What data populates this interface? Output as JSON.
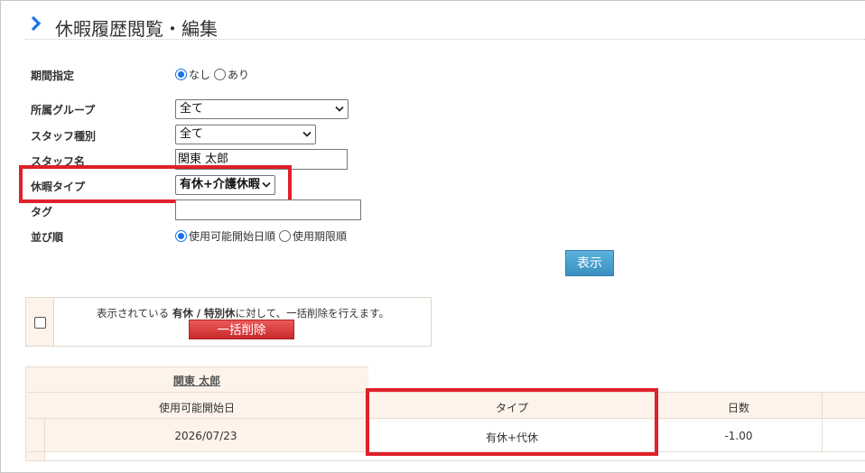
{
  "page": {
    "title": "休暇履歴閲覧・編集"
  },
  "form": {
    "period": {
      "label": "期間指定",
      "options": [
        {
          "label": "なし",
          "selected": true
        },
        {
          "label": "あり",
          "selected": false
        }
      ]
    },
    "group": {
      "label": "所属グループ",
      "value": "全て"
    },
    "staff_type": {
      "label": "スタッフ種別",
      "value": "全て"
    },
    "staff_name": {
      "label": "スタッフ名",
      "value": "関東 太郎"
    },
    "leave_type": {
      "label": "休暇タイプ",
      "value": "有休+介護休暇"
    },
    "tag": {
      "label": "タグ",
      "value": ""
    },
    "sort": {
      "label": "並び順",
      "options": [
        {
          "label": "使用可能開始日順",
          "selected": true
        },
        {
          "label": "使用期限順",
          "selected": false
        }
      ]
    },
    "show_button": "表示"
  },
  "bulk": {
    "message_prefix": "表示されている ",
    "message_bold": "有休 / 特別休",
    "message_suffix": "に対して、一括削除を行えます。",
    "delete_button": "一括削除"
  },
  "table": {
    "staff_link": "関東 太郎",
    "headers": [
      "使用可能開始日",
      "タイプ",
      "日数"
    ],
    "rows": [
      {
        "start_date": "2026/07/23",
        "type": "有休+代休",
        "days": "-1.00"
      }
    ]
  },
  "colors": {
    "highlight": "#e0202a",
    "accent": "#1a73e8",
    "header_bg": "#fdf3ea"
  }
}
